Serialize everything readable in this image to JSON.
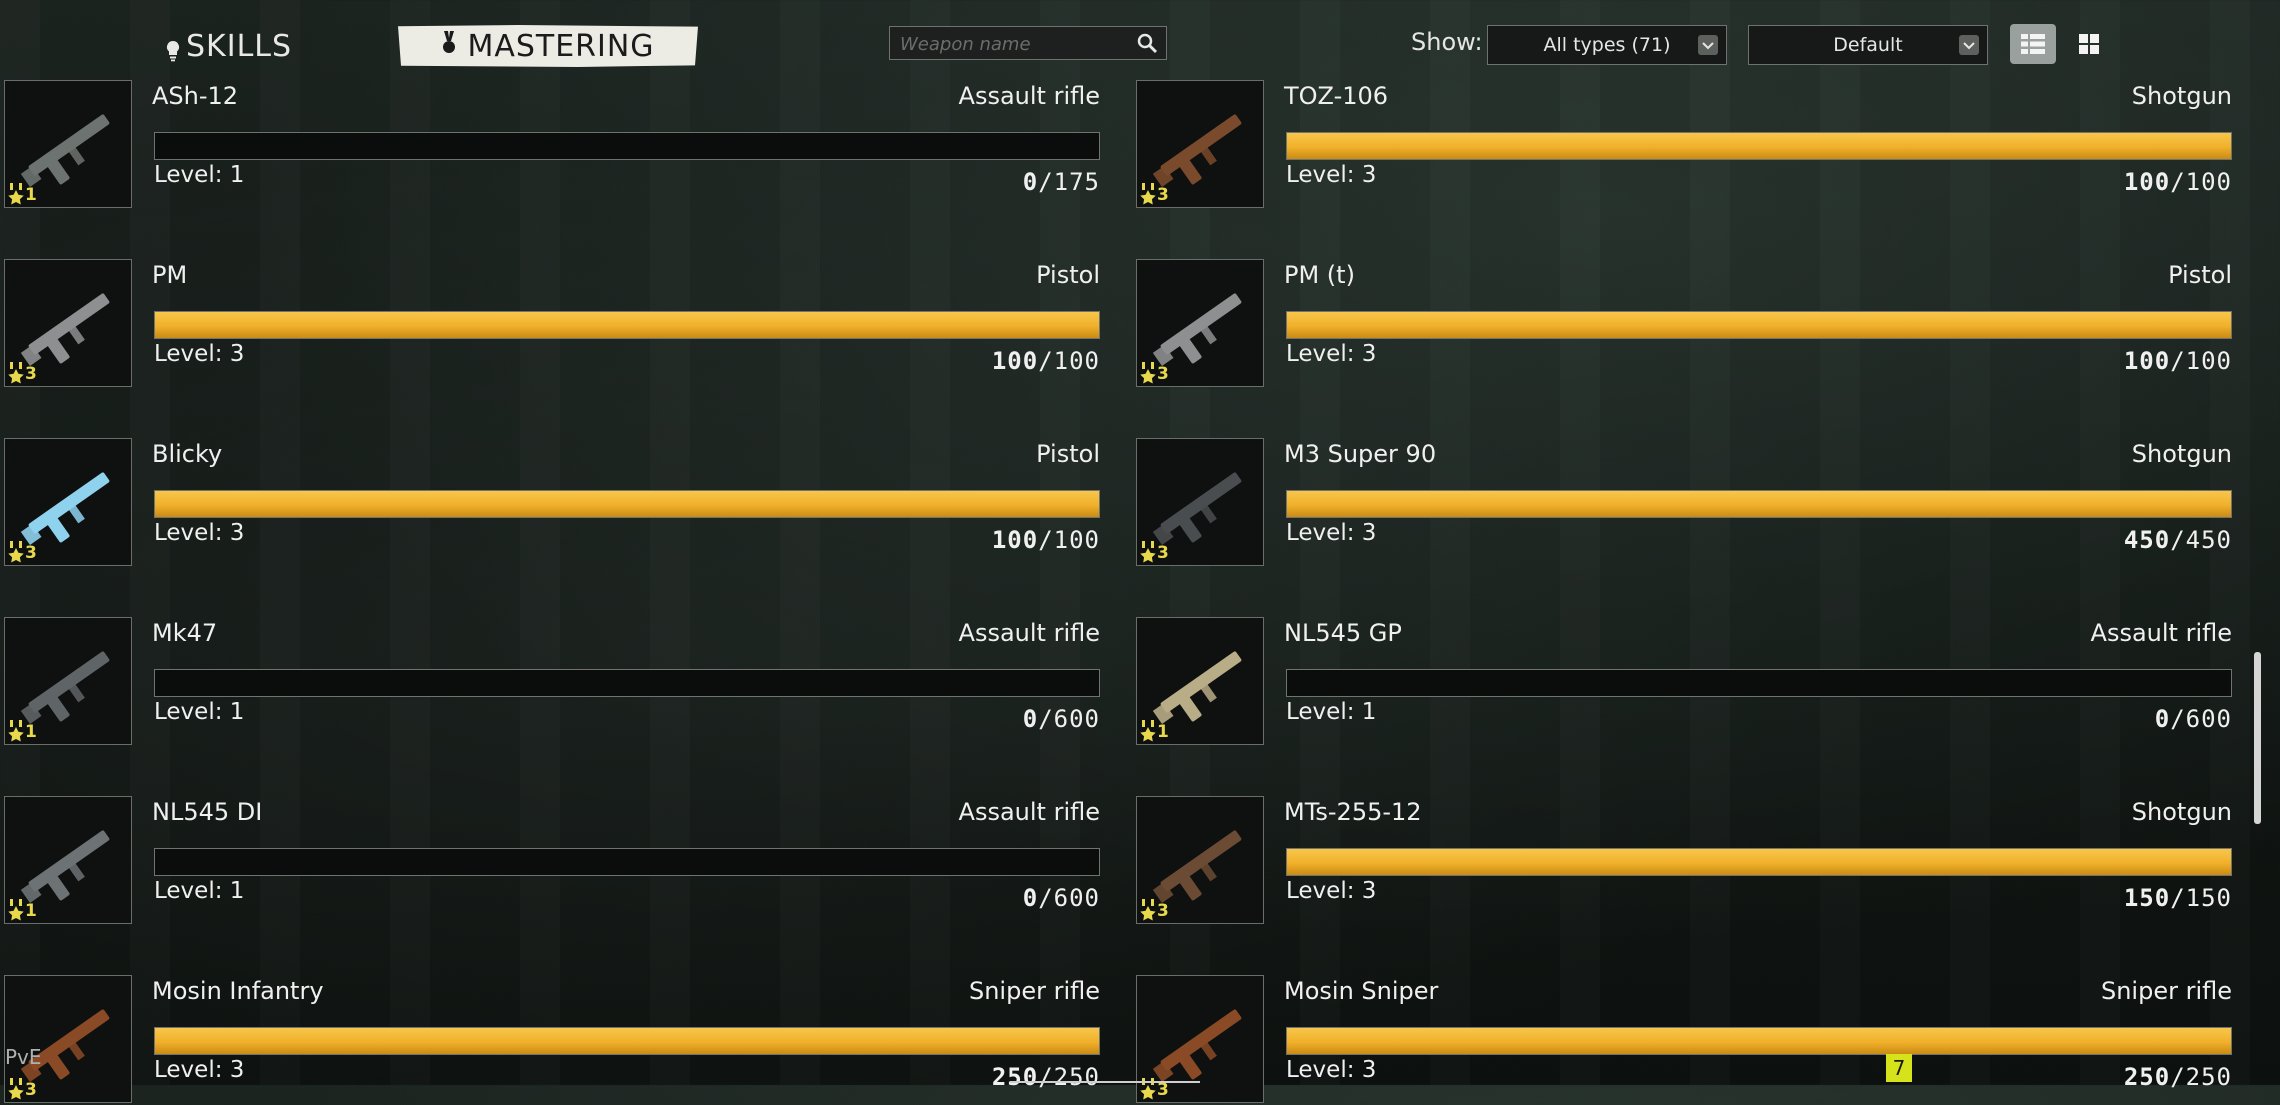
{
  "header": {
    "tab_skills": "SKILLS",
    "tab_mastering": "MASTERING",
    "search_placeholder": "Weapon name",
    "show_label": "Show:",
    "type_filter": "All types (71)",
    "sort_option": "Default"
  },
  "weapons": [
    {
      "name": "ASh-12",
      "type": "Assault rifle",
      "level_text": "Level: 1",
      "badge": "1",
      "current": "0",
      "max": "/175",
      "progress": 0,
      "color": "#6d7370"
    },
    {
      "name": "TOZ-106",
      "type": "Shotgun",
      "level_text": "Level: 3",
      "badge": "3",
      "current": "100",
      "max": "/100",
      "progress": 1,
      "color": "#7a4a2c"
    },
    {
      "name": "PM",
      "type": "Pistol",
      "level_text": "Level: 3",
      "badge": "3",
      "current": "100",
      "max": "/100",
      "progress": 1,
      "color": "#8d8f91"
    },
    {
      "name": "PM (t)",
      "type": "Pistol",
      "level_text": "Level: 3",
      "badge": "3",
      "current": "100",
      "max": "/100",
      "progress": 1,
      "color": "#8d8f91"
    },
    {
      "name": "Blicky",
      "type": "Pistol",
      "level_text": "Level: 3",
      "badge": "3",
      "current": "100",
      "max": "/100",
      "progress": 1,
      "color": "#8fd2ee"
    },
    {
      "name": "M3 Super 90",
      "type": "Shotgun",
      "level_text": "Level: 3",
      "badge": "3",
      "current": "450",
      "max": "/450",
      "progress": 1,
      "color": "#4a4d4f"
    },
    {
      "name": "Mk47",
      "type": "Assault rifle",
      "level_text": "Level: 1",
      "badge": "1",
      "current": "0",
      "max": "/600",
      "progress": 0,
      "color": "#5f6466"
    },
    {
      "name": "NL545 GP",
      "type": "Assault rifle",
      "level_text": "Level: 1",
      "badge": "1",
      "current": "0",
      "max": "/600",
      "progress": 0,
      "color": "#b8ad86"
    },
    {
      "name": "NL545 DI",
      "type": "Assault rifle",
      "level_text": "Level: 1",
      "badge": "1",
      "current": "0",
      "max": "/600",
      "progress": 0,
      "color": "#6d7275"
    },
    {
      "name": "MTs-255-12",
      "type": "Shotgun",
      "level_text": "Level: 3",
      "badge": "3",
      "current": "150",
      "max": "/150",
      "progress": 1,
      "color": "#6b4b33"
    },
    {
      "name": "Mosin Infantry",
      "type": "Sniper rifle",
      "level_text": "Level: 3",
      "badge": "3",
      "current": "250",
      "max": "/250",
      "progress": 1,
      "color": "#8a4a26"
    },
    {
      "name": "Mosin Sniper",
      "type": "Sniper rifle",
      "level_text": "Level: 3",
      "badge": "3",
      "current": "250",
      "max": "/250",
      "progress": 1,
      "color": "#8a4a26"
    }
  ],
  "footer": {
    "mode": "PvE",
    "notification_count": "7"
  }
}
